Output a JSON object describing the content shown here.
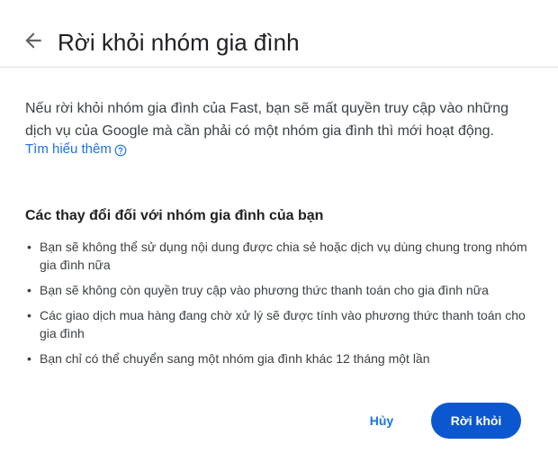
{
  "header": {
    "back_icon": "arrow-back-icon",
    "title": "Rời khỏi nhóm gia đình"
  },
  "intro": {
    "text": "Nếu rời khỏi nhóm gia đình của Fast, bạn sẽ mất quyền truy cập vào những dịch vụ của Google mà cần phải có một nhóm gia đình thì mới hoạt động.",
    "learn_more": "Tìm hiểu thêm",
    "learn_more_icon": "help-circle-icon"
  },
  "changes": {
    "title": "Các thay đổi đối với nhóm gia đình của bạn",
    "items": [
      "Bạn sẽ không thể sử dụng nội dung được chia sẻ hoặc dịch vụ dùng chung trong nhóm gia đình nữa",
      "Bạn sẽ không còn quyền truy cập vào phương thức thanh toán cho gia đình nữa",
      "Các giao dịch mua hàng đang chờ xử lý sẽ được tính vào phương thức thanh toán cho gia đình",
      "Bạn chỉ có thể chuyển sang một nhóm gia đình khác 12 tháng một lần"
    ]
  },
  "actions": {
    "cancel_label": "Hủy",
    "leave_label": "Rời khỏi"
  },
  "colors": {
    "accent": "#1a73e8",
    "primary_button": "#0b57d0",
    "divider": "#dadce0"
  }
}
